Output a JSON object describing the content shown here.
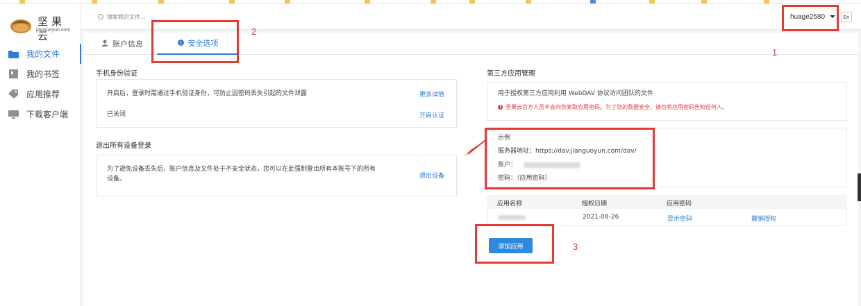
{
  "sidebar": {
    "logo_cn": "坚果云",
    "logo_en": "jianguoyun.com",
    "items": [
      {
        "label": "我的文件",
        "icon": "folder-icon"
      },
      {
        "label": "我的书签",
        "icon": "bookmark-icon"
      },
      {
        "label": "应用推荐",
        "icon": "tag-icon"
      },
      {
        "label": "下载客户端",
        "icon": "monitor-icon"
      }
    ]
  },
  "header": {
    "search_placeholder": "搜索我的文件...",
    "username": "huage2580",
    "lang": "En"
  },
  "tabs": [
    {
      "label": "账户信息",
      "icon": "user-icon"
    },
    {
      "label": "安全选项",
      "icon": "info-icon"
    }
  ],
  "phone_verify": {
    "title": "手机身份验证",
    "desc": "开启后，登录时需通过手机验证身份，可防止因密码丢失引起的文件泄露",
    "more": "更多详情",
    "status": "已关闭",
    "enable": "开启认证"
  },
  "logout_all": {
    "title": "退出所有设备登录",
    "desc_line1": "为了避免设备丢失后，账户信息及文件处于不安全状态，您可以在此强制登出所有本账号下的所有",
    "desc_line2": "设备。",
    "action": "退出设备"
  },
  "third_party": {
    "title": "第三方应用管理",
    "desc": "用于授权第三方应用利用 WebDAV 协议访问团队的文件",
    "warning": "坚果云官方人员不会向您索取应用密码。为了您的数据安全，请勿将应用密码告知任何人。",
    "example_title": "示例",
    "server_label": "服务器地址：",
    "server_url": "https://dav.jianguoyun.com/dav/",
    "account_label": "账户：",
    "password_label": "密码：",
    "password_value": "（应用密码）",
    "table": {
      "headers": [
        "应用名称",
        "授权日期",
        "应用密码"
      ],
      "row": {
        "date": "2021-08-26",
        "show_pw": "显示密码",
        "revoke": "撤销授权"
      }
    },
    "add_button": "添加应用"
  },
  "annotations": [
    "1",
    "2",
    "3"
  ],
  "colors": {
    "accent": "#2e7cd6",
    "annotation": "#e53935",
    "warning": "#e03b3b"
  }
}
